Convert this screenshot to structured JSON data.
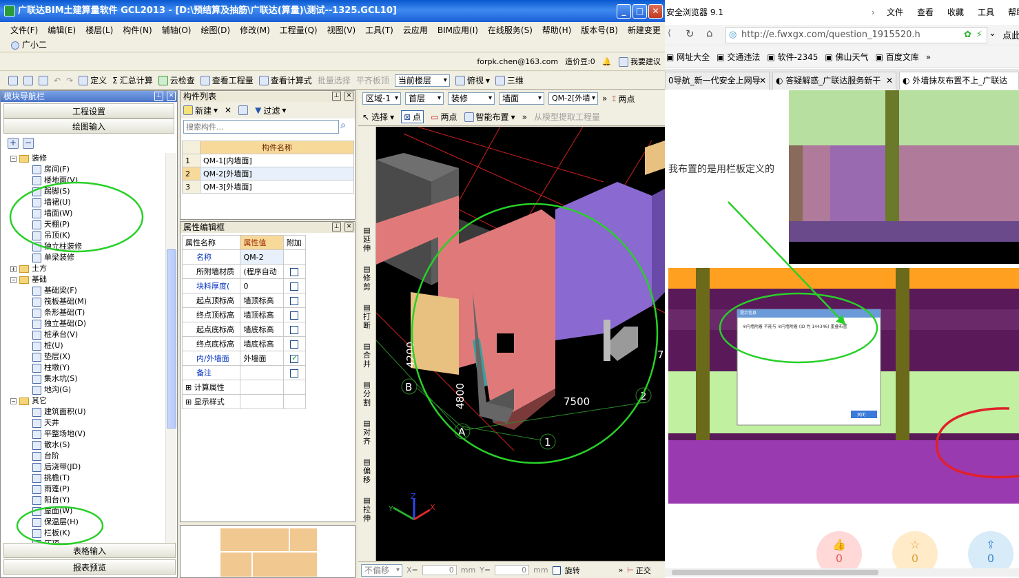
{
  "app": {
    "title": "广联达BIM土建算量软件 GCL2013 - [D:\\预结算及抽筋\\广联达(算量)\\测试--1325.GCL10]",
    "menus": [
      "文件(F)",
      "编辑(E)",
      "楼层(L)",
      "构件(N)",
      "辅轴(O)",
      "绘图(D)",
      "修改(M)",
      "工程量(Q)",
      "视图(V)",
      "工具(T)",
      "云应用",
      "BIM应用(I)",
      "在线服务(S)",
      "帮助(H)",
      "版本号(B)",
      "新建变更"
    ],
    "assistant": "广小二",
    "account": "forpk.chen@163.com",
    "beans": "造价豆:0",
    "suggest": "我要建议"
  },
  "toolbar": {
    "define": "定义",
    "summary": "汇总计算",
    "cloud_check": "云检查",
    "view_qty": "查看工程量",
    "view_formula": "查看计算式",
    "batch_select": "批量选择",
    "flat_slab": "平齐板顶",
    "floor_select": "当前楼层",
    "top_view": "俯视",
    "three_d": "三维"
  },
  "nav": {
    "title": "模块导航栏",
    "project_settings": "工程设置",
    "drawing_input": "绘图输入",
    "table_input": "表格输入",
    "report_preview": "报表预览",
    "tree": [
      {
        "label": "装修",
        "level": 0,
        "type": "folder",
        "exp": "−"
      },
      {
        "label": "房间(F)",
        "level": 1,
        "type": "leaf"
      },
      {
        "label": "楼地面(V)",
        "level": 1,
        "type": "leaf"
      },
      {
        "label": "踢脚(S)",
        "level": 1,
        "type": "leaf"
      },
      {
        "label": "墙裙(U)",
        "level": 1,
        "type": "leaf"
      },
      {
        "label": "墙面(W)",
        "level": 1,
        "type": "leaf"
      },
      {
        "label": "天棚(P)",
        "level": 1,
        "type": "leaf"
      },
      {
        "label": "吊顶(K)",
        "level": 1,
        "type": "leaf"
      },
      {
        "label": "独立柱装修",
        "level": 1,
        "type": "leaf"
      },
      {
        "label": "单梁装修",
        "level": 1,
        "type": "leaf"
      },
      {
        "label": "土方",
        "level": 0,
        "type": "folder",
        "exp": "+"
      },
      {
        "label": "基础",
        "level": 0,
        "type": "folder",
        "exp": "−"
      },
      {
        "label": "基础梁(F)",
        "level": 1,
        "type": "leaf"
      },
      {
        "label": "筏板基础(M)",
        "level": 1,
        "type": "leaf"
      },
      {
        "label": "条形基础(T)",
        "level": 1,
        "type": "leaf"
      },
      {
        "label": "独立基础(D)",
        "level": 1,
        "type": "leaf"
      },
      {
        "label": "桩承台(V)",
        "level": 1,
        "type": "leaf"
      },
      {
        "label": "桩(U)",
        "level": 1,
        "type": "leaf"
      },
      {
        "label": "垫层(X)",
        "level": 1,
        "type": "leaf"
      },
      {
        "label": "柱墩(Y)",
        "level": 1,
        "type": "leaf"
      },
      {
        "label": "集水坑(S)",
        "level": 1,
        "type": "leaf"
      },
      {
        "label": "地沟(G)",
        "level": 1,
        "type": "leaf"
      },
      {
        "label": "其它",
        "level": 0,
        "type": "folder",
        "exp": "−"
      },
      {
        "label": "建筑面积(U)",
        "level": 1,
        "type": "leaf"
      },
      {
        "label": "天井",
        "level": 1,
        "type": "leaf"
      },
      {
        "label": "平整场地(V)",
        "level": 1,
        "type": "leaf"
      },
      {
        "label": "散水(S)",
        "level": 1,
        "type": "leaf"
      },
      {
        "label": "台阶",
        "level": 1,
        "type": "leaf"
      },
      {
        "label": "后浇带(JD)",
        "level": 1,
        "type": "leaf"
      },
      {
        "label": "挑檐(T)",
        "level": 1,
        "type": "leaf"
      },
      {
        "label": "雨蓬(P)",
        "level": 1,
        "type": "leaf"
      },
      {
        "label": "阳台(Y)",
        "level": 1,
        "type": "leaf"
      },
      {
        "label": "屋面(W)",
        "level": 1,
        "type": "leaf"
      },
      {
        "label": "保温层(H)",
        "level": 1,
        "type": "leaf"
      },
      {
        "label": "栏板(K)",
        "level": 1,
        "type": "leaf"
      },
      {
        "label": "压顶",
        "level": 1,
        "type": "leaf"
      }
    ]
  },
  "components": {
    "title": "构件列表",
    "new": "新建",
    "filter": "过滤",
    "search_placeholder": "搜索构件...",
    "header": "构件名称",
    "rows": [
      {
        "no": "1",
        "name": "QM-1[内墙面]"
      },
      {
        "no": "2",
        "name": "QM-2[外墙面]"
      },
      {
        "no": "3",
        "name": "QM-3[外墙面]"
      }
    ]
  },
  "props": {
    "title": "属性编辑框",
    "headers": [
      "属性名称",
      "属性值",
      "附加"
    ],
    "rows": [
      {
        "name": "名称",
        "value": "QM-2",
        "check": "none",
        "blue": true
      },
      {
        "name": "所附墙材质",
        "value": "(程序自动",
        "check": "off",
        "blue": false
      },
      {
        "name": "块料厚度(",
        "value": "0",
        "check": "off",
        "blue": true
      },
      {
        "name": "起点顶标高",
        "value": "墙顶标高",
        "check": "off",
        "blue": false
      },
      {
        "name": "终点顶标高",
        "value": "墙顶标高",
        "check": "off",
        "blue": false
      },
      {
        "name": "起点底标高",
        "value": "墙底标高",
        "check": "off",
        "blue": false
      },
      {
        "name": "终点底标高",
        "value": "墙底标高",
        "check": "off",
        "blue": false
      },
      {
        "name": "内/外墙面",
        "value": "外墙面",
        "check": "on",
        "blue": true
      },
      {
        "name": "备注",
        "value": "",
        "check": "off",
        "blue": true
      },
      {
        "name": "计算属性",
        "value": "",
        "check": "none",
        "blue": false,
        "group": true
      },
      {
        "name": "显示样式",
        "value": "",
        "check": "none",
        "blue": false,
        "group": true
      }
    ]
  },
  "drawbar": {
    "area": "区域-1",
    "floor": "首层",
    "category": "装修",
    "type": "墙面",
    "component": "QM-2[外墙",
    "two_points": "两点",
    "select": "选择",
    "point": "点",
    "two_point2": "两点",
    "smart": "智能布置",
    "extract": "从模型提取工程量"
  },
  "vtools": [
    "延伸",
    "修剪",
    "打断",
    "合并",
    "分割",
    "对齐",
    "偏移",
    "拉伸"
  ],
  "canvas": {
    "dims": [
      "4200",
      "4800",
      "7500"
    ],
    "axes": [
      "A",
      "B",
      "1",
      "2",
      "7"
    ],
    "axis_x": "X",
    "axis_y": "Y",
    "axis_z": "Z"
  },
  "status": {
    "offset": "不偏移",
    "x_label": "X=",
    "x_val": "0",
    "y_label": "Y=",
    "y_val": "0",
    "unit": "mm",
    "rotate": "旋转",
    "ortho": "正交"
  },
  "browser": {
    "title": "安全浏览器 9.1",
    "menus": [
      "文件",
      "查看",
      "收藏",
      "工具",
      "帮助"
    ],
    "url": "http://e.fwxgx.com/question_1915520.h",
    "side_btn": "点此",
    "bookmarks": [
      "网址大全",
      "交通违法",
      "软件-2345",
      "佛山天气",
      "百度文库"
    ],
    "tabs": [
      "0导航_新一代安全上网导",
      "答疑解惑_广联达服务新干",
      "外墙抹灰布置不上_广联达"
    ],
    "question_text": "我布置的是用栏板定义的",
    "dialog_title": "提示信息",
    "dialog_msg": "※内墙附着 不能与 ※内墙附着 (ID 为 144346) 重叠布置",
    "dialog_btn": "关闭",
    "action_counts": [
      "0",
      "0",
      "0"
    ]
  }
}
